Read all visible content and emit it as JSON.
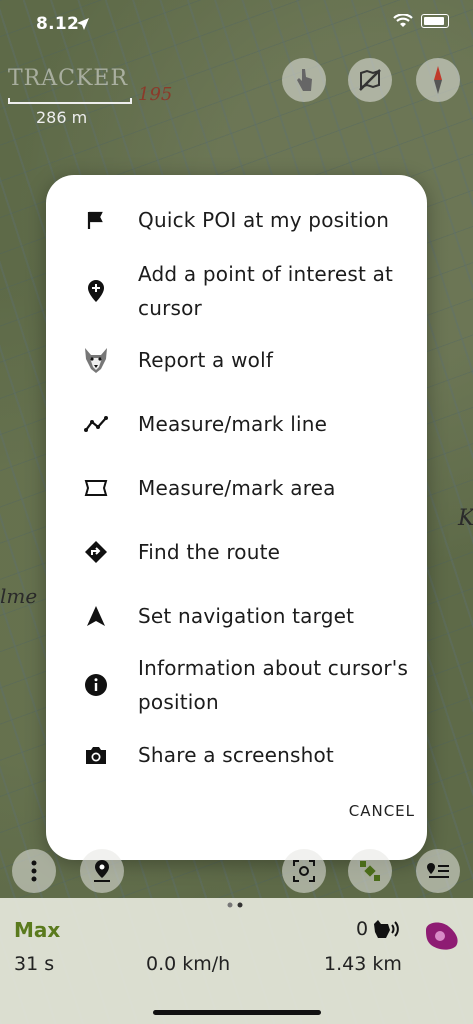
{
  "status_bar": {
    "time": "8.12"
  },
  "map": {
    "logo_text": "TRACKER",
    "scale_label": "286 m",
    "contour_label": "195",
    "place_label_left": "lme",
    "place_label_right": "K"
  },
  "menu": {
    "items": [
      {
        "label": "Quick POI at my position",
        "icon": "flag-icon"
      },
      {
        "label": "Add a point of interest at cursor",
        "icon": "add-location-pin-icon"
      },
      {
        "label": "Report a wolf",
        "icon": "wolf-icon"
      },
      {
        "label": "Measure/mark line",
        "icon": "polyline-icon"
      },
      {
        "label": "Measure/mark area",
        "icon": "area-shape-icon"
      },
      {
        "label": "Find the route",
        "icon": "directions-icon"
      },
      {
        "label": "Set navigation target",
        "icon": "navigation-arrow-icon"
      },
      {
        "label": "Information about cursor's position",
        "icon": "info-icon"
      },
      {
        "label": "Share a screenshot",
        "icon": "camera-icon"
      }
    ],
    "cancel_label": "CANCEL"
  },
  "bottom_panel": {
    "name": "Max",
    "duration": "31 s",
    "speed": "0.0 km/h",
    "distance": "1.43 km",
    "bark_count": "0"
  }
}
